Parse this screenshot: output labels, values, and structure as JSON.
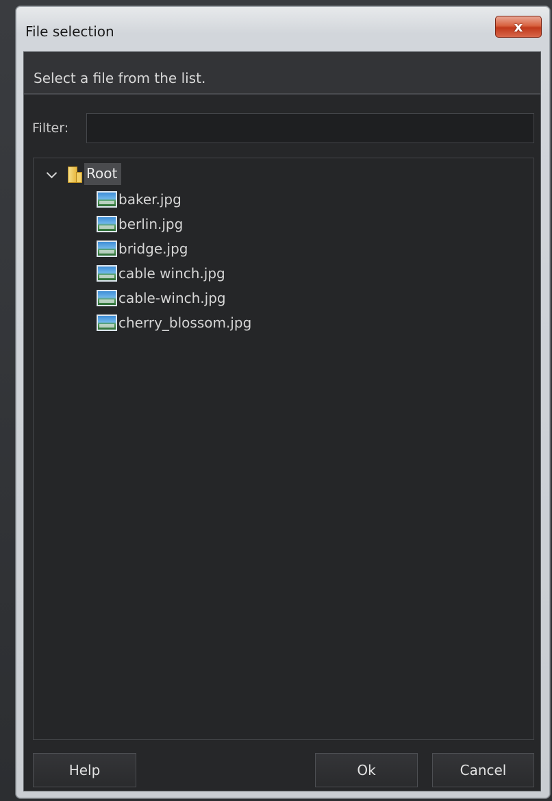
{
  "window": {
    "title": "File selection",
    "close_glyph": "x"
  },
  "instruction": "Select a file from the list.",
  "filter": {
    "label": "Filter:",
    "value": "",
    "placeholder": ""
  },
  "tree": {
    "root_label": "Root",
    "root_expanded": true,
    "files": [
      {
        "name": "baker.jpg",
        "icon": "image-file-icon"
      },
      {
        "name": "berlin.jpg",
        "icon": "image-file-icon"
      },
      {
        "name": "bridge.jpg",
        "icon": "image-file-icon"
      },
      {
        "name": "cable winch.jpg",
        "icon": "image-file-icon"
      },
      {
        "name": "cable-winch.jpg",
        "icon": "image-file-icon"
      },
      {
        "name": "cherry_blossom.jpg",
        "icon": "image-file-icon"
      }
    ]
  },
  "buttons": {
    "help": "Help",
    "ok": "Ok",
    "cancel": "Cancel"
  },
  "colors": {
    "close_button": "#c0391b",
    "panel_background": "#262729",
    "text": "#d6d6d6"
  }
}
